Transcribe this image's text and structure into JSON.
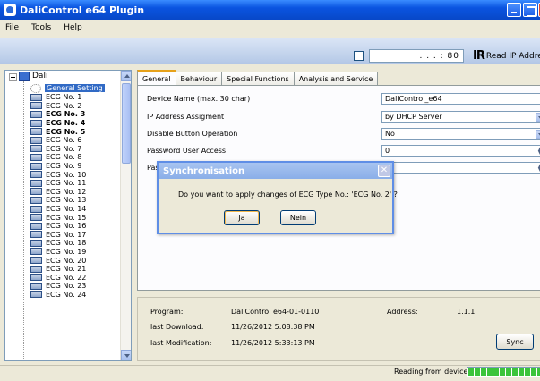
{
  "window": {
    "title": "DaliControl e64 Plugin"
  },
  "menu": [
    "File",
    "Tools",
    "Help"
  ],
  "toolbar": {
    "ip_value": ". . . : 80",
    "read_ip_label": "Read IP Addres"
  },
  "tree": {
    "root": "Dali",
    "items": [
      {
        "label": "General Setting",
        "selected": true
      },
      {
        "label": "ECG No. 1"
      },
      {
        "label": "ECG No. 2"
      },
      {
        "label": "ECG No. 3",
        "bold": true
      },
      {
        "label": "ECG No. 4",
        "bold": true
      },
      {
        "label": "ECG No. 5",
        "bold": true
      },
      {
        "label": "ECG No. 6"
      },
      {
        "label": "ECG No. 7"
      },
      {
        "label": "ECG No. 8"
      },
      {
        "label": "ECG No. 9"
      },
      {
        "label": "ECG No. 10"
      },
      {
        "label": "ECG No. 11"
      },
      {
        "label": "ECG No. 12"
      },
      {
        "label": "ECG No. 13"
      },
      {
        "label": "ECG No. 14"
      },
      {
        "label": "ECG No. 15"
      },
      {
        "label": "ECG No. 16"
      },
      {
        "label": "ECG No. 17"
      },
      {
        "label": "ECG No. 18"
      },
      {
        "label": "ECG No. 19"
      },
      {
        "label": "ECG No. 20"
      },
      {
        "label": "ECG No. 21"
      },
      {
        "label": "ECG No. 22"
      },
      {
        "label": "ECG No. 23"
      },
      {
        "label": "ECG No. 24"
      }
    ]
  },
  "tabs": [
    "General",
    "Behaviour",
    "Special Functions",
    "Analysis and Service"
  ],
  "form": {
    "device_name_label": "Device Name (max. 30 char)",
    "device_name_value": "DaliControl_e64",
    "ip_assign_label": "IP Address Assigment",
    "ip_assign_value": "by DHCP Server",
    "disable_btn_label": "Disable Button Operation",
    "disable_btn_value": "No",
    "password_label": "Password User Access",
    "password_value": "0",
    "row5_label_partial": "Pas"
  },
  "info": {
    "program_label": "Program:",
    "program_value": "DaliControl e64-01-0110",
    "address_label": "Address:",
    "address_value": "1.1.1",
    "last_download_label": "last Download:",
    "last_download_value": "11/26/2012 5:08:38 PM",
    "last_mod_label": "last Modification:",
    "last_mod_value": "11/26/2012 5:33:13 PM",
    "sync_label": "Sync"
  },
  "status": {
    "text": "Reading from device",
    "progress": 1.0
  },
  "dialog": {
    "title": "Synchronisation",
    "message": "Do you want to apply changes of ECG Type No.: 'ECG No. 2' ?",
    "yes_label": "Ja",
    "no_label": "Nein"
  }
}
